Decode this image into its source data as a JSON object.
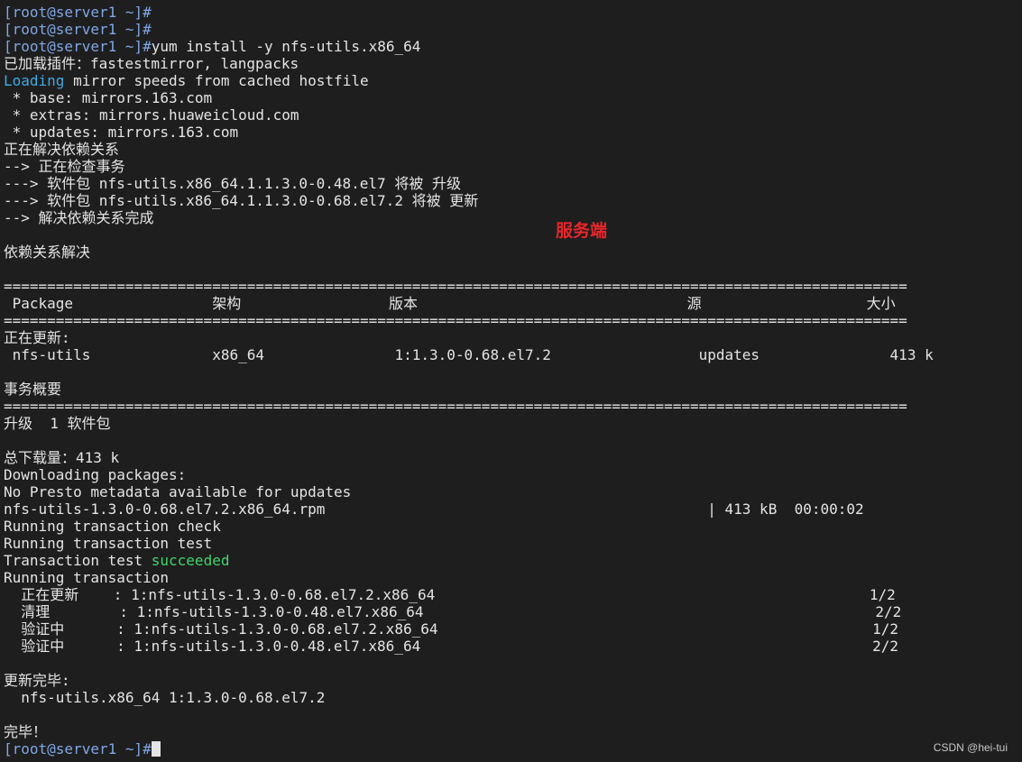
{
  "terminal": {
    "colors": {
      "background": "#1e1e1e",
      "text": "#e4e4e4",
      "prompt": "#7fa6e6",
      "loading": "#3fa9e6",
      "success": "#3fd56a",
      "annotation": "#e8262b"
    },
    "lines": [
      [
        {
          "t": "[root@server1 ~]#",
          "c": "prompt"
        }
      ],
      [
        {
          "t": "[root@server1 ~]#",
          "c": "prompt"
        }
      ],
      [
        {
          "t": "[root@server1 ~]#",
          "c": "prompt"
        },
        {
          "t": "yum install -y nfs-utils.x86_64",
          "c": "normal"
        }
      ],
      [
        {
          "t": "已加载插件：fastestmirror, langpacks",
          "c": "normal"
        }
      ],
      [
        {
          "t": "Loading",
          "c": "loading"
        },
        {
          "t": " mirror speeds from cached hostfile",
          "c": "normal"
        }
      ],
      [
        {
          "t": " * base: mirrors.163.com",
          "c": "normal"
        }
      ],
      [
        {
          "t": " * extras: mirrors.huaweicloud.com",
          "c": "normal"
        }
      ],
      [
        {
          "t": " * updates: mirrors.163.com",
          "c": "normal"
        }
      ],
      [
        {
          "t": "正在解决依赖关系",
          "c": "normal"
        }
      ],
      [
        {
          "t": "--> 正在检查事务",
          "c": "normal"
        }
      ],
      [
        {
          "t": "---> 软件包 nfs-utils.x86_64.1.1.3.0-0.48.el7 将被 升级",
          "c": "normal"
        }
      ],
      [
        {
          "t": "---> 软件包 nfs-utils.x86_64.1.1.3.0-0.68.el7.2 将被 更新",
          "c": "normal"
        }
      ],
      [
        {
          "t": "--> 解决依赖关系完成",
          "c": "normal"
        }
      ],
      [],
      [
        {
          "t": "依赖关系解决",
          "c": "normal"
        }
      ],
      [],
      [
        {
          "t": "========================================================================================================",
          "c": "normal"
        }
      ],
      [
        {
          "t": " Package                架构                 版本                               源                   大小",
          "c": "normal"
        }
      ],
      [
        {
          "t": "========================================================================================================",
          "c": "normal"
        }
      ],
      [
        {
          "t": "正在更新:",
          "c": "normal"
        }
      ],
      [
        {
          "t": " nfs-utils              x86_64               1:1.3.0-0.68.el7.2                 updates               413 k",
          "c": "normal"
        }
      ],
      [],
      [
        {
          "t": "事务概要",
          "c": "normal"
        }
      ],
      [
        {
          "t": "========================================================================================================",
          "c": "normal"
        }
      ],
      [
        {
          "t": "升级  1 软件包",
          "c": "normal"
        }
      ],
      [],
      [
        {
          "t": "总下载量：413 k",
          "c": "normal"
        }
      ],
      [
        {
          "t": "Downloading packages:",
          "c": "normal"
        }
      ],
      [
        {
          "t": "No Presto metadata available for updates",
          "c": "normal"
        }
      ],
      [
        {
          "t": "nfs-utils-1.3.0-0.68.el7.2.x86_64.rpm                                            | 413 kB  00:00:02",
          "c": "normal"
        }
      ],
      [
        {
          "t": "Running transaction check",
          "c": "normal"
        }
      ],
      [
        {
          "t": "Running transaction test",
          "c": "normal"
        }
      ],
      [
        {
          "t": "Transaction test ",
          "c": "normal"
        },
        {
          "t": "succeeded",
          "c": "success"
        }
      ],
      [
        {
          "t": "Running transaction",
          "c": "normal"
        }
      ],
      [
        {
          "t": "  正在更新    : 1:nfs-utils-1.3.0-0.68.el7.2.x86_64                                                  1/2",
          "c": "normal"
        }
      ],
      [
        {
          "t": "  清理        : 1:nfs-utils-1.3.0-0.48.el7.x86_64                                                    2/2",
          "c": "normal"
        }
      ],
      [
        {
          "t": "  验证中      : 1:nfs-utils-1.3.0-0.68.el7.2.x86_64                                                  1/2",
          "c": "normal"
        }
      ],
      [
        {
          "t": "  验证中      : 1:nfs-utils-1.3.0-0.48.el7.x86_64                                                    2/2",
          "c": "normal"
        }
      ],
      [],
      [
        {
          "t": "更新完毕:",
          "c": "normal"
        }
      ],
      [
        {
          "t": "  nfs-utils.x86_64 1:1.3.0-0.68.el7.2",
          "c": "normal"
        }
      ],
      [],
      [
        {
          "t": "完毕！",
          "c": "normal"
        }
      ],
      [
        {
          "t": "[root@server1 ~]#",
          "c": "prompt"
        }
      ]
    ]
  },
  "annotation": {
    "label": "服务端"
  },
  "watermark": {
    "text": "CSDN @hei-tui"
  }
}
